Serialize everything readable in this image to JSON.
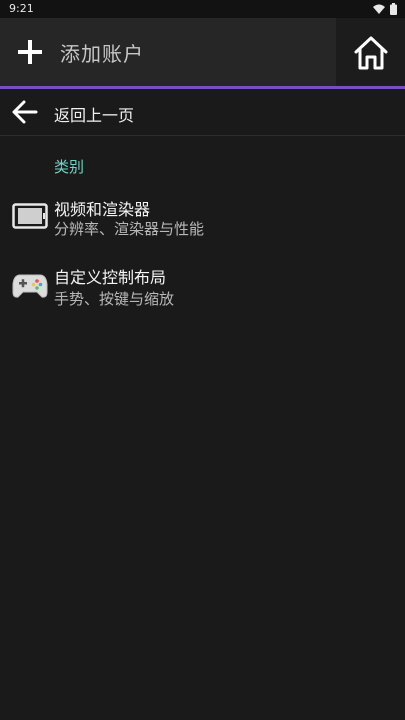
{
  "status_bar": {
    "time": "9:21",
    "icons": [
      "wifi-icon",
      "battery-icon"
    ]
  },
  "app_bar": {
    "add_icon": "plus-icon",
    "title": "添加账户",
    "home_icon": "home-icon",
    "accent_color": "#7c4cc8"
  },
  "back_row": {
    "icon": "back-arrow-icon",
    "label": "返回上一页"
  },
  "category": {
    "label": "类别",
    "color": "#6fd3c4"
  },
  "items": [
    {
      "icon": "display-icon",
      "title": "视频和渲染器",
      "subtitle": "分辨率、渲染器与性能"
    },
    {
      "icon": "gamepad-icon",
      "title": "自定义控制布局",
      "subtitle": "手势、按键与缩放"
    }
  ]
}
